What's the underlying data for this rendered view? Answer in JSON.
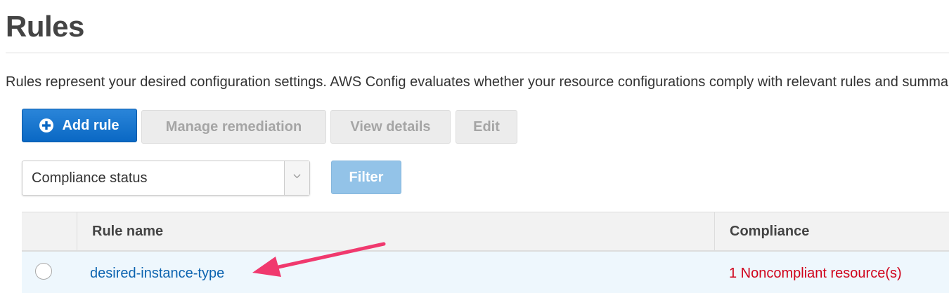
{
  "page": {
    "title": "Rules",
    "description": "Rules represent your desired configuration settings. AWS Config evaluates whether your resource configurations comply with relevant rules and summarizes the compliance results."
  },
  "toolbar": {
    "add_rule_label": "Add rule",
    "manage_remediation_label": "Manage remediation",
    "view_details_label": "View details",
    "edit_label": "Edit"
  },
  "filter": {
    "select_value": "Compliance status",
    "filter_button_label": "Filter"
  },
  "table": {
    "columns": {
      "rule_name": "Rule name",
      "compliance": "Compliance"
    },
    "rows": [
      {
        "rule_name": "desired-instance-type",
        "compliance": "1 Noncompliant resource(s)"
      }
    ]
  },
  "icons": {
    "add": "plus-circle-icon",
    "select": "chevron-down-icon",
    "annotation": "arrow-icon"
  },
  "colors": {
    "primary": "#0a68c4",
    "link": "#0b63b0",
    "noncompliant": "#d0021b",
    "annotation": "#f0396e",
    "row_highlight": "#eef7fd"
  }
}
